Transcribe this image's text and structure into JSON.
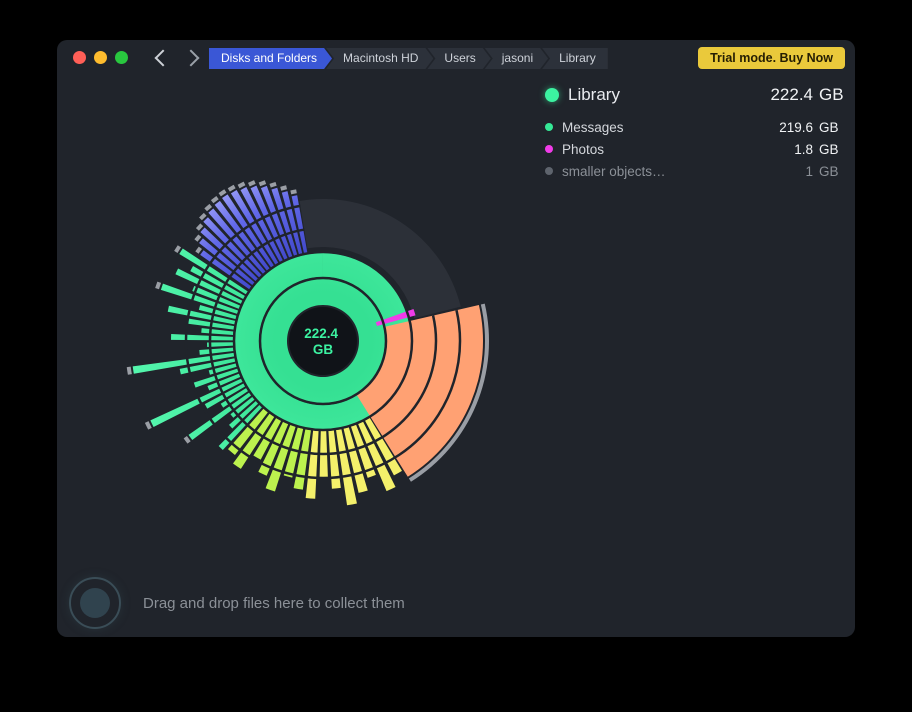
{
  "window": {
    "breadcrumbs": [
      {
        "label": "Disks and Folders"
      },
      {
        "label": "Macintosh HD"
      },
      {
        "label": "Users"
      },
      {
        "label": "jasoni"
      },
      {
        "label": "Library"
      }
    ],
    "trial_button": "Trial mode. Buy Now"
  },
  "legend": {
    "primary": {
      "label": "Library",
      "value": "222.4",
      "unit": "GB",
      "color": "#3CF2A1"
    },
    "rows": [
      {
        "label": "Messages",
        "value": "219.6",
        "unit": "GB",
        "color": "#35E896"
      },
      {
        "label": "Photos",
        "value": "1.8",
        "unit": "GB",
        "color": "#F03CE8"
      },
      {
        "label": "smaller objects…",
        "value": "1",
        "unit": "GB",
        "color": "#5E646D"
      }
    ]
  },
  "dropzone": {
    "text": "Drag and drop files here to collect them"
  },
  "chart_data": {
    "type": "sunburst",
    "title": "",
    "center_label": {
      "value": "222.4",
      "unit": "GB"
    },
    "items": [
      {
        "label": "Library",
        "size_gb": 222.4,
        "color": "#3CF2A1"
      },
      {
        "label": "Messages",
        "size_gb": 219.6,
        "color": "#35E896"
      },
      {
        "label": "Photos",
        "size_gb": 1.8,
        "color": "#F03CE8"
      },
      {
        "label": "smaller objects…",
        "size_gb": 1,
        "color": "#5E646D"
      }
    ],
    "geometry": {
      "center": [
        240,
        240
      ],
      "bg": "#20242B",
      "cap_color": "#9A9EA5",
      "center_hole": {
        "r": 34,
        "fill": "#101318",
        "text_color": "#3CF2A1"
      },
      "segments": [
        {
          "name": "ring-inner",
          "a0": 0,
          "a1": 360,
          "r0": 36,
          "r1": 62,
          "fill": "green"
        },
        {
          "name": "ring-second",
          "a0": 0,
          "a1": 360,
          "r0": 64,
          "r1": 88,
          "fill": "green"
        },
        {
          "name": "free-space-arc",
          "a0": -9.5,
          "a1": 76,
          "r0": 94,
          "r1": 142,
          "fill": "#2C3038"
        },
        {
          "name": "photos-sliver",
          "a0": 70.5,
          "a1": 74.5,
          "r0": 56,
          "r1": 96,
          "fill": "#F03CE8"
        },
        {
          "name": "orange-wedge",
          "a0": 77,
          "a1": 148,
          "r0": 64,
          "r1": 160,
          "fill": "#FFA173",
          "rim": true
        },
        {
          "name": "yellow-bars",
          "a0": 148,
          "a1": 187,
          "r0": 90,
          "fill": "#F4F06B",
          "stripes": 8,
          "gap": 1.4,
          "outers": [
            152,
            163,
            144,
            156,
            166,
            148,
            138,
            158
          ]
        },
        {
          "name": "lime-bars",
          "a0": 187,
          "a1": 222,
          "r0": 90,
          "fill": "#BCF24E",
          "stripes": 7,
          "gap": 1.4,
          "outers": [
            150,
            140,
            158,
            146,
            134,
            152,
            144
          ]
        },
        {
          "name": "green-bars",
          "a0": 222,
          "a1": 304,
          "r0": 90,
          "fill": "green",
          "stripes": 24,
          "gap": 1.2,
          "cap_min": 164,
          "outers": [
            148,
            126,
            118,
            164,
            120,
            134,
            190,
            124,
            138,
            118,
            146,
            192,
            124,
            116,
            152,
            122,
            136,
            158,
            128,
            170,
            140,
            162,
            150,
            168
          ]
        },
        {
          "name": "blue-bars",
          "a0": 304.5,
          "a1": 350.5,
          "r0": 90,
          "fill": "blue",
          "stripes": 14,
          "gap": 1.1,
          "cap_min": 0,
          "outers": [
            150,
            158,
            164,
            169,
            172,
            174,
            175,
            174,
            172,
            169,
            165,
            160,
            154,
            148
          ]
        }
      ],
      "separators": [
        {
          "a0": 0,
          "a1": 360,
          "r": 63,
          "w": 2.5
        },
        {
          "a0": 0,
          "a1": 360,
          "r": 89,
          "w": 2.5
        },
        {
          "a0": 77,
          "a1": 350.5,
          "r": 113,
          "w": 2.5
        },
        {
          "a0": 77,
          "a1": 350.5,
          "r": 137,
          "w": 2.5
        }
      ]
    }
  }
}
